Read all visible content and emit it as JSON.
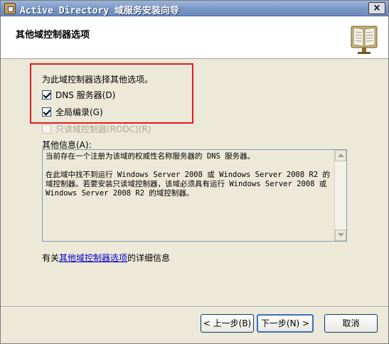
{
  "window": {
    "title": "Active Directory 域服务安装向导",
    "close_glyph": "×"
  },
  "header": {
    "title": "其他域控制器选项",
    "icon": "book-icon"
  },
  "options": {
    "prompt": "为此域控制器选择其他选项。",
    "dns": {
      "label": "DNS 服务器(D)",
      "checked": true
    },
    "gc": {
      "label": "全局编录(G)",
      "checked": true
    },
    "rodc": {
      "label": "只读域控制器(RODC)(R)",
      "checked": false,
      "enabled": false
    }
  },
  "info": {
    "label": "其他信息(A):",
    "paragraph1": "当前存在一个注册为该域的权威性名称服务器的 DNS 服务器。",
    "paragraph2": "在此域中找不到运行 Windows Server 2008 或 Windows Server 2008 R2 的域控制器。若要安装只读域控制器，该域必须具有运行 Windows Server 2008 或 Windows Server 2008 R2 的域控制器。"
  },
  "help": {
    "prefix": "有关",
    "link": "其他域控制器选项",
    "suffix": "的详细信息"
  },
  "buttons": {
    "back": "< 上一步(B)",
    "next": "下一步(N) >",
    "cancel": "取消"
  },
  "colors": {
    "highlight": "#e31b23",
    "link": "#0000cc",
    "dialog_bg": "#ece9d8"
  }
}
